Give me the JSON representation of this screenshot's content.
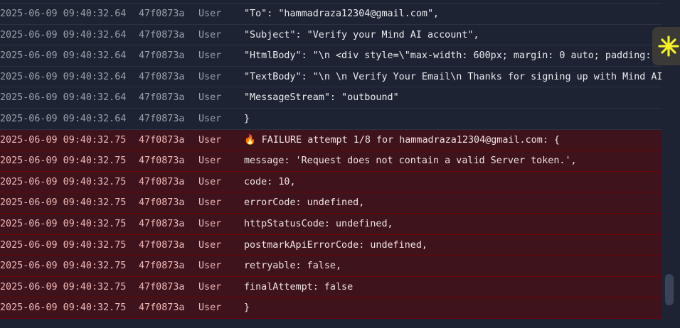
{
  "rows": [
    {
      "ts": "2025-06-09 09:40:32.64",
      "id": "47f0873a",
      "source": "User",
      "msg": "\"To\": \"hammadraza12304@gmail.com\",",
      "level": "info"
    },
    {
      "ts": "2025-06-09 09:40:32.64",
      "id": "47f0873a",
      "source": "User",
      "msg": "\"Subject\": \"Verify your Mind AI account\",",
      "level": "info"
    },
    {
      "ts": "2025-06-09 09:40:32.64",
      "id": "47f0873a",
      "source": "User",
      "msg": "\"HtmlBody\": \"\\n <div style=\\\"max-width: 600px; margin: 0 auto; padding:",
      "level": "info"
    },
    {
      "ts": "2025-06-09 09:40:32.64",
      "id": "47f0873a",
      "source": "User",
      "msg": "\"TextBody\": \"\\n \\n Verify Your Email\\n Thanks for signing up with Mind AI",
      "level": "info"
    },
    {
      "ts": "2025-06-09 09:40:32.64",
      "id": "47f0873a",
      "source": "User",
      "msg": "\"MessageStream\": \"outbound\"",
      "level": "info"
    },
    {
      "ts": "2025-06-09 09:40:32.64",
      "id": "47f0873a",
      "source": "User",
      "msg": "}",
      "level": "info"
    },
    {
      "ts": "2025-06-09 09:40:32.75",
      "id": "47f0873a",
      "source": "User",
      "msg": "🔥 FAILURE attempt 1/8 for hammadraza12304@gmail.com: {",
      "level": "error"
    },
    {
      "ts": "2025-06-09 09:40:32.75",
      "id": "47f0873a",
      "source": "User",
      "msg": "message: 'Request does not contain a valid Server token.',",
      "level": "error"
    },
    {
      "ts": "2025-06-09 09:40:32.75",
      "id": "47f0873a",
      "source": "User",
      "msg": "code: 10,",
      "level": "error"
    },
    {
      "ts": "2025-06-09 09:40:32.75",
      "id": "47f0873a",
      "source": "User",
      "msg": "errorCode: undefined,",
      "level": "error"
    },
    {
      "ts": "2025-06-09 09:40:32.75",
      "id": "47f0873a",
      "source": "User",
      "msg": "httpStatusCode: undefined,",
      "level": "error"
    },
    {
      "ts": "2025-06-09 09:40:32.75",
      "id": "47f0873a",
      "source": "User",
      "msg": "postmarkApiErrorCode: undefined,",
      "level": "error"
    },
    {
      "ts": "2025-06-09 09:40:32.75",
      "id": "47f0873a",
      "source": "User",
      "msg": "retryable: false,",
      "level": "error"
    },
    {
      "ts": "2025-06-09 09:40:32.75",
      "id": "47f0873a",
      "source": "User",
      "msg": "finalAttempt: false",
      "level": "error"
    },
    {
      "ts": "2025-06-09 09:40:32.75",
      "id": "47f0873a",
      "source": "User",
      "msg": "}",
      "level": "error"
    }
  ],
  "badge_icon": "asterisk-icon",
  "colors": {
    "accent": "#f5f125",
    "error_bg": "#3e131b",
    "error_border": "#6e0308",
    "bg": "#1d2332"
  }
}
